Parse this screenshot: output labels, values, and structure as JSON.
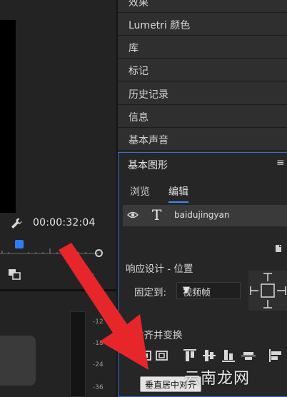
{
  "program_monitor": {
    "timecode": "00:00:32:04",
    "meter_labels": [
      "-12",
      "-18",
      "-24",
      "-36"
    ]
  },
  "panels": {
    "items": [
      {
        "label": "效果"
      },
      {
        "label": "Lumetri 颜色"
      },
      {
        "label": "库"
      },
      {
        "label": "标记"
      },
      {
        "label": "历史记录"
      },
      {
        "label": "信息"
      },
      {
        "label": "基本声音"
      }
    ]
  },
  "essential_graphics": {
    "title": "基本图形",
    "menu_icon": "≡",
    "tabs": [
      {
        "label": "浏览",
        "active": false
      },
      {
        "label": "编辑",
        "active": true
      }
    ],
    "layer": {
      "type_glyph": "T",
      "name": "baidujingyan"
    },
    "responsive_design_label": "响应设计 - 位置",
    "pin_to_label": "固定到:",
    "pin_to_value": "视频帧",
    "align_transform_label": "对齐并变换",
    "tooltip": "垂直居中对齐"
  },
  "watermark": "云南龙网",
  "colors": {
    "accent_blue": "#3b8cf0",
    "panel_border": "#3b6fc9",
    "arrow_red": "#e6262b"
  },
  "icons": [
    "wrench-icon",
    "playhead-icon",
    "export-frame-icon",
    "add-icon",
    "eye-icon",
    "text-layer-icon",
    "new-layer-icon",
    "pin-position-widget",
    "align-top-icon",
    "align-vertical-center-icon",
    "align-bottom-icon",
    "distribute-icon",
    "align-left-icon"
  ]
}
